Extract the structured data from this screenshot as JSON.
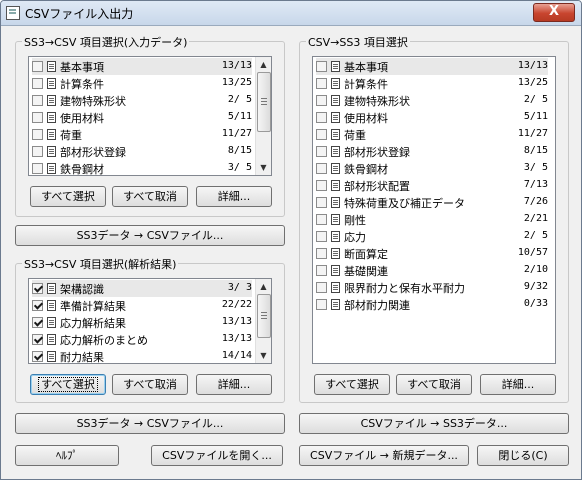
{
  "window": {
    "title": "CSVファイル入出力",
    "close_label": "X"
  },
  "group_input": {
    "legend": "SS3→CSV 項目選択(入力データ)",
    "items": [
      {
        "label": "基本事項",
        "count": "13/13",
        "checked": false
      },
      {
        "label": "計算条件",
        "count": "13/25",
        "checked": false
      },
      {
        "label": "建物特殊形状",
        "count": "2/ 5",
        "checked": false
      },
      {
        "label": "使用材料",
        "count": "5/11",
        "checked": false
      },
      {
        "label": "荷重",
        "count": "11/27",
        "checked": false
      },
      {
        "label": "部材形状登録",
        "count": "8/15",
        "checked": false
      },
      {
        "label": "鉄骨鋼材",
        "count": "3/ 5",
        "checked": false
      }
    ],
    "btn_select_all": "すべて選択",
    "btn_clear_all": "すべて取消",
    "btn_detail": "詳細..."
  },
  "btn_export_input": "SS3データ → CSVファイル...",
  "group_analysis": {
    "legend": "SS3→CSV 項目選択(解析結果)",
    "items": [
      {
        "label": "架構認識",
        "count": "3/ 3",
        "checked": true
      },
      {
        "label": "準備計算結果",
        "count": "22/22",
        "checked": true
      },
      {
        "label": "応力解析結果",
        "count": "13/13",
        "checked": true
      },
      {
        "label": "応力解析のまとめ",
        "count": "13/13",
        "checked": true
      },
      {
        "label": "耐力結果",
        "count": "14/14",
        "checked": true
      }
    ],
    "btn_select_all": "すべて選択",
    "btn_clear_all": "すべて取消",
    "btn_detail": "詳細..."
  },
  "btn_export_analysis": "SS3データ → CSVファイル...",
  "group_csv_to_ss3": {
    "legend": "CSV→SS3 項目選択",
    "items": [
      {
        "label": "基本事項",
        "count": "13/13",
        "checked": false
      },
      {
        "label": "計算条件",
        "count": "13/25",
        "checked": false
      },
      {
        "label": "建物特殊形状",
        "count": "2/ 5",
        "checked": false
      },
      {
        "label": "使用材料",
        "count": "5/11",
        "checked": false
      },
      {
        "label": "荷重",
        "count": "11/27",
        "checked": false
      },
      {
        "label": "部材形状登録",
        "count": "8/15",
        "checked": false
      },
      {
        "label": "鉄骨鋼材",
        "count": "3/ 5",
        "checked": false
      },
      {
        "label": "部材形状配置",
        "count": "7/13",
        "checked": false
      },
      {
        "label": "特殊荷重及び補正データ",
        "count": "7/26",
        "checked": false
      },
      {
        "label": "剛性",
        "count": "2/21",
        "checked": false
      },
      {
        "label": "応力",
        "count": "2/ 5",
        "checked": false
      },
      {
        "label": "断面算定",
        "count": "10/57",
        "checked": false
      },
      {
        "label": "基礎関連",
        "count": "2/10",
        "checked": false
      },
      {
        "label": "限界耐力と保有水平耐力",
        "count": "9/32",
        "checked": false
      },
      {
        "label": "部材耐力関連",
        "count": "0/33",
        "checked": false
      }
    ],
    "btn_select_all": "すべて選択",
    "btn_clear_all": "すべて取消",
    "btn_detail": "詳細..."
  },
  "btn_import": "CSVファイル → SS3データ...",
  "footer": {
    "help": "ﾍﾙﾌﾟ",
    "open_csv": "CSVファイルを開く...",
    "new_data": "CSVファイル → 新規データ...",
    "close": "閉じる(C)"
  }
}
